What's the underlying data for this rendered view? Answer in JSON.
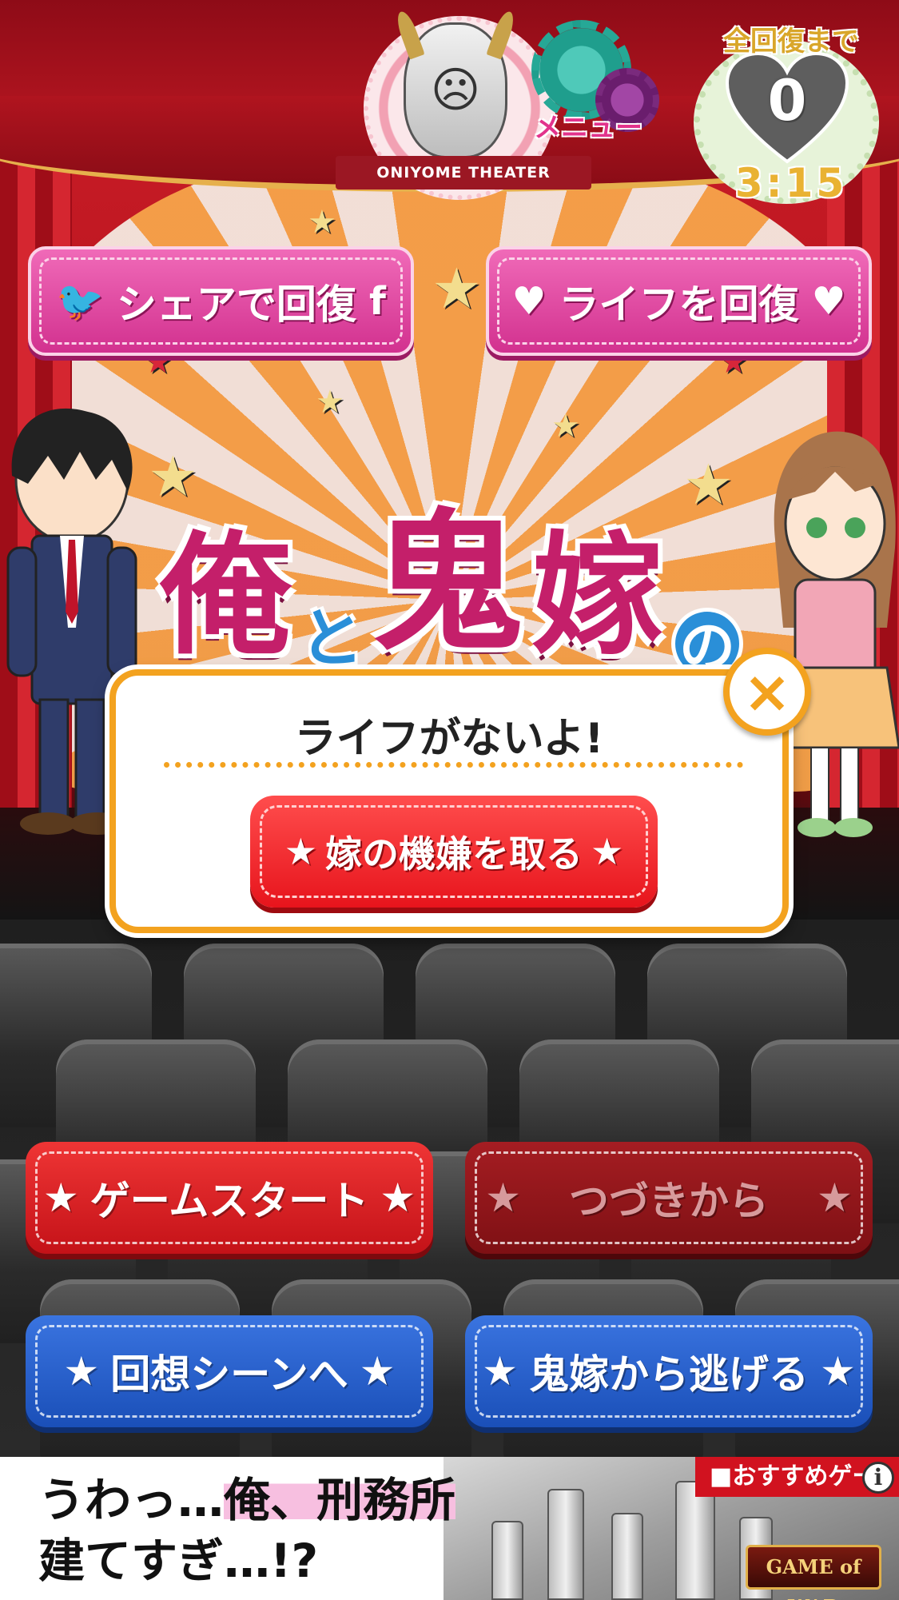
{
  "header": {
    "theater_banner": "ONIYOME THEATER",
    "menu_label": "メニュー",
    "recover_label": "全回復まで",
    "life_count": "0",
    "timer": "3:15"
  },
  "top_buttons": {
    "share_label": "シェアで回復",
    "life_label": "ライフを回復"
  },
  "title": {
    "char1": "俺",
    "char2": "と",
    "char3": "鬼",
    "char4": "嫁",
    "char5": "の"
  },
  "dialog": {
    "title": "ライフがないよ!",
    "button_label": "嫁の機嫌を取る",
    "close_glyph": "×"
  },
  "menu": {
    "start_label": "ゲームスタート",
    "continue_label": "つづきから",
    "recall_label": "回想シーンへ",
    "escape_label": "鬼嫁から逃げる"
  },
  "ad": {
    "line1_prefix": "うわっ…",
    "line1_highlight": "俺、刑務所",
    "line2": "建てすぎ…!?",
    "tag": "■おすすめゲー",
    "info": "i",
    "logo": "GAME of WAR"
  },
  "colors": {
    "accent_orange": "#f3a21f",
    "pink_button": "#d2318f",
    "red_button": "#e7141c",
    "blue_button": "#1a4fb8"
  },
  "icons": {
    "twitter": "bird-icon",
    "facebook": "facebook-icon",
    "heart": "heart-icon",
    "star": "star-icon",
    "close": "close-icon",
    "gear": "gear-icon"
  }
}
